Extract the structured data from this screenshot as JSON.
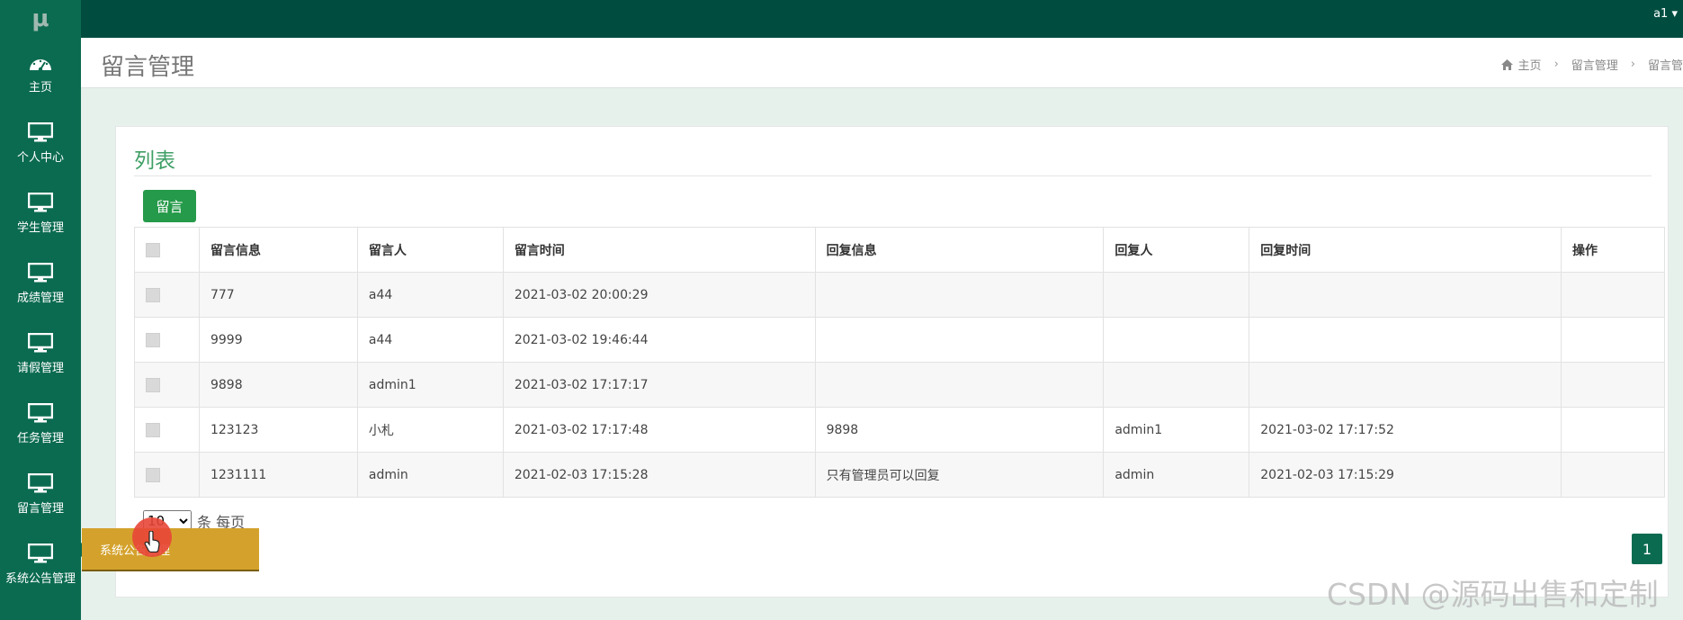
{
  "app": {
    "logo": "μ",
    "user": "a1 ▾"
  },
  "sidebar": {
    "items": [
      {
        "label": "主页",
        "icon": "dashboard-icon"
      },
      {
        "label": "个人中心",
        "icon": "monitor-icon"
      },
      {
        "label": "学生管理",
        "icon": "monitor-icon"
      },
      {
        "label": "成绩管理",
        "icon": "monitor-icon"
      },
      {
        "label": "请假管理",
        "icon": "monitor-icon"
      },
      {
        "label": "任务管理",
        "icon": "monitor-icon"
      },
      {
        "label": "留言管理",
        "icon": "monitor-icon"
      },
      {
        "label": "系统公告管理",
        "icon": "monitor-icon"
      }
    ],
    "flyout": "系统公告管理"
  },
  "header": {
    "title": "留言管理",
    "breadcrumb": [
      "主页",
      "留言管理",
      "留言管"
    ]
  },
  "card": {
    "title": "列表",
    "add_button": "留言",
    "columns": [
      "",
      "留言信息",
      "留言人",
      "留言时间",
      "回复信息",
      "回复人",
      "回复时间",
      "操作"
    ],
    "rows": [
      [
        "777",
        "a44",
        "2021-03-02 20:00:29",
        "",
        "",
        ""
      ],
      [
        "9999",
        "a44",
        "2021-03-02 19:46:44",
        "",
        "",
        ""
      ],
      [
        "9898",
        "admin1",
        "2021-03-02 17:17:17",
        "",
        "",
        ""
      ],
      [
        "123123",
        "小札",
        "2021-03-02 17:17:48",
        "9898",
        "admin1",
        "2021-03-02 17:17:52"
      ],
      [
        "1231111",
        "admin",
        "2021-02-03 17:15:28",
        "只有管理员可以回复",
        "admin",
        "2021-02-03 17:15:29"
      ]
    ]
  },
  "pager": {
    "size_value": "10",
    "size_suffix": "条 每页",
    "current_page": "1"
  },
  "watermark": "CSDN @源码出售和定制",
  "colors": {
    "topbar": "#004d40",
    "sidebar": "#0b6b50",
    "accent": "#259a4a",
    "flyout": "#d4a22c"
  }
}
